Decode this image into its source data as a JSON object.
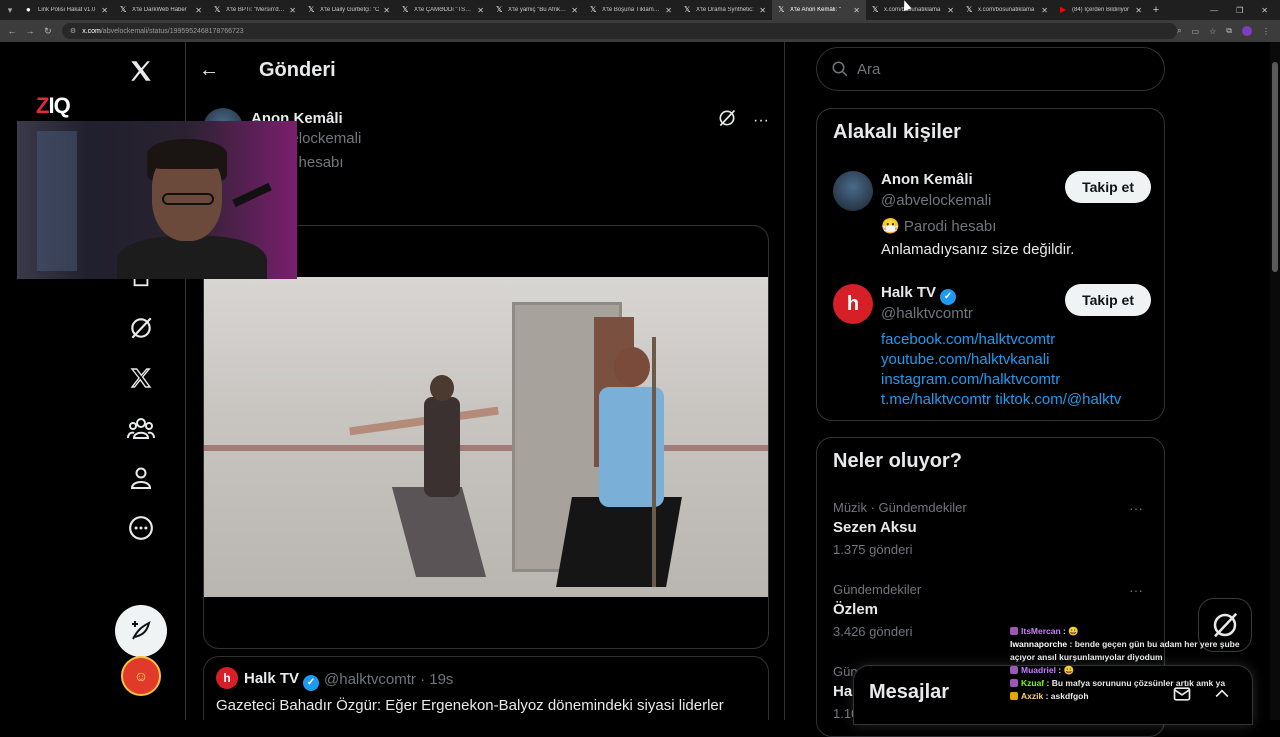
{
  "browser": {
    "tabs": [
      {
        "title": "Link Polisi Hakat v1.0"
      },
      {
        "title": "X'te DarkWeb Haber"
      },
      {
        "title": "X'te BPTi: \"Mersin'de b"
      },
      {
        "title": "X'te Daily Gurbetçi: \"C"
      },
      {
        "title": "X'te ÇAMƏDDi \"TSK S"
      },
      {
        "title": "X'te yamiç \"Bu Afrika/A"
      },
      {
        "title": "X'te Boşuna Tıklama: \""
      },
      {
        "title": "X'te Drama Synthetic:"
      },
      {
        "title": "X'te Anon Kemâli: \""
      },
      {
        "title": "x.com/bosunatiklama"
      },
      {
        "title": "x.com/bosunatiklama"
      },
      {
        "title": "(84) İçerden Bildiriyor"
      }
    ],
    "url_domain": "x.com",
    "url_path": "/abvelockemali/status/1995952468178766723"
  },
  "overlay": {
    "logo_z": "Z",
    "logo_rest": "IQ"
  },
  "main": {
    "title": "Gönderi",
    "tweet": {
      "name": "Anon Kemâli",
      "handle": "@abvelockemali",
      "parody": "Parodi hesabı"
    },
    "reply": {
      "name": "Halk TV",
      "handle": "@halktvcomtr · 19s",
      "text": "Gazeteci Bahadır Özgür: Eğer Ergenekon-Balyoz dönemindeki siyasi liderler",
      "avatar_letter": "h"
    }
  },
  "search": {
    "placeholder": "Ara"
  },
  "related": {
    "title": "Alakalı kişiler",
    "people": [
      {
        "name": "Anon Kemâli",
        "handle": "@abvelockemali",
        "parody": "Parodi hesabı",
        "bio": "Anlamadıysanız size değildir.",
        "follow": "Takip et"
      },
      {
        "name": "Halk TV",
        "handle": "@halktvcomtr",
        "links": [
          "facebook.com/halktvcomtr",
          "youtube.com/halktvkanali",
          "instagram.com/halktvcomtr",
          "t.me/halktvcomtr tiktok.com/@halktv"
        ],
        "follow": "Takip et"
      }
    ]
  },
  "trends": {
    "title": "Neler oluyor?",
    "items": [
      {
        "meta": "Müzik · Gündemdekiler",
        "name": "Sezen Aksu",
        "count": "1.375 gönderi"
      },
      {
        "meta": "Gündemdekiler",
        "name": "Özlem",
        "count": "3.426 gönderi"
      },
      {
        "meta": "Gün",
        "name": "Ha",
        "count": "1.10"
      }
    ]
  },
  "messages": {
    "title": "Mesajlar"
  },
  "chat": [
    {
      "user": "ItsMercan",
      "text": " : 😀",
      "color": "#c77dff"
    },
    {
      "user": "Iwannaporche",
      "text": " : bende geçen gün bu adam her yere şube",
      "color": "#ffffff"
    },
    {
      "user": "",
      "text": "açıyor ansıl kurşunlamıyolar diyodum",
      "color": "#ffffff"
    },
    {
      "user": "Muadriel",
      "text": " : 😀",
      "color": "#c77dff"
    },
    {
      "user": "Kzuaf",
      "text": " : Bu mafya sorununu çözsünler artık amk ya",
      "color": "#7CFC00"
    },
    {
      "user": "Axzik",
      "text": " : askdfgoh",
      "color": "#ffd166"
    }
  ],
  "colors": {
    "accent": "#1d9bf0",
    "background": "#000000",
    "border": "#2f3336"
  }
}
